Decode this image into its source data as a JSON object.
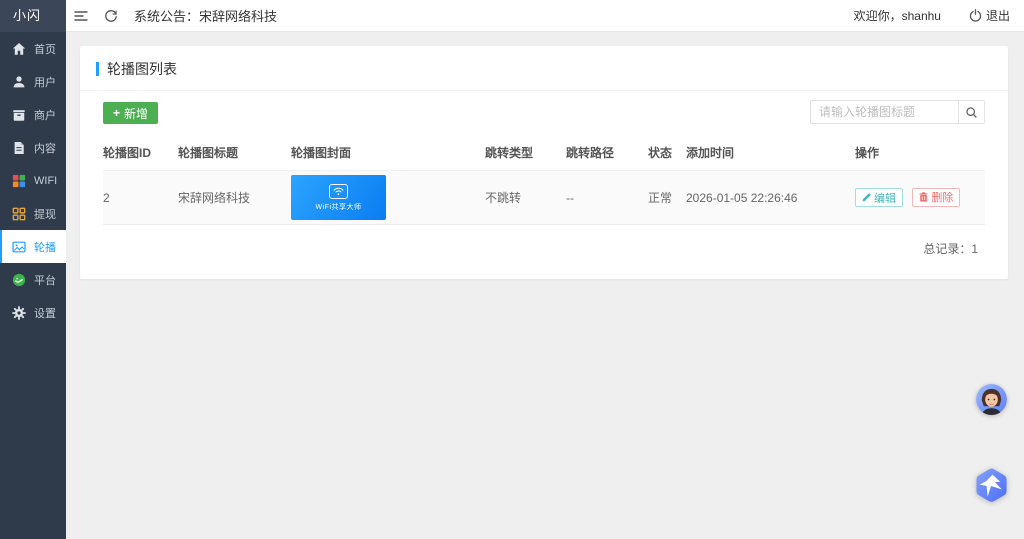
{
  "app": {
    "logo": "小闪"
  },
  "header": {
    "announcement": "系统公告：宋辞网络科技",
    "welcome": "欢迎你，shanhu",
    "logout_label": "退出"
  },
  "sidebar": {
    "items": [
      {
        "label": "首页",
        "icon": "home-icon"
      },
      {
        "label": "用户",
        "icon": "user-icon"
      },
      {
        "label": "商户",
        "icon": "merchant-icon"
      },
      {
        "label": "内容",
        "icon": "content-icon"
      },
      {
        "label": "WIFI",
        "icon": "wifi-grid-icon"
      },
      {
        "label": "提现",
        "icon": "withdraw-grid-icon"
      },
      {
        "label": "轮播",
        "icon": "carousel-icon",
        "active": true
      },
      {
        "label": "平台",
        "icon": "platform-icon"
      },
      {
        "label": "设置",
        "icon": "gear-icon"
      }
    ]
  },
  "page": {
    "title": "轮播图列表",
    "add_button": "新增",
    "search_placeholder": "请输入轮播图标题",
    "table": {
      "headers": [
        "轮播图ID",
        "轮播图标题",
        "轮播图封面",
        "跳转类型",
        "跳转路径",
        "状态",
        "添加时间",
        "操作"
      ],
      "row": {
        "id": "2",
        "title": "宋辞网络科技",
        "cover_text": "WiFi共享大师",
        "jump_type": "不跳转",
        "jump_path": "--",
        "status": "正常",
        "added_time": "2026-01-05 22:26:46",
        "edit_label": "编辑",
        "delete_label": "删除"
      }
    },
    "total_label": "总记录：1"
  },
  "colors": {
    "accent_blue": "#1e9fff",
    "sidebar_bg": "#2f3a4a",
    "logo_bg": "#3b4658",
    "add_green": "#4cb052",
    "edit_teal": "#45b5b5",
    "delete_red": "#f26c6c",
    "banner_gradient_start": "#2ba4ff",
    "banner_gradient_end": "#0b7df1"
  }
}
